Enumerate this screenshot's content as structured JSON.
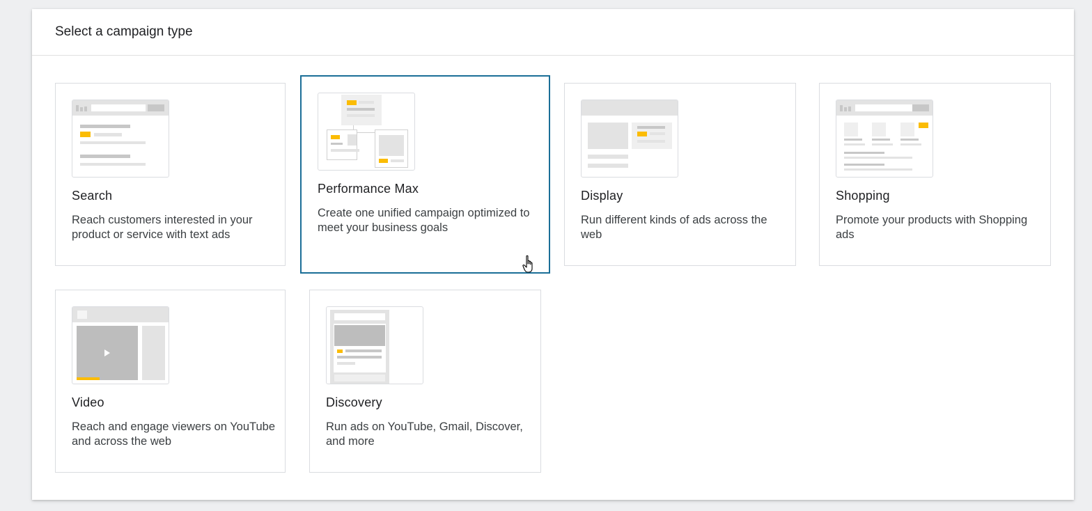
{
  "dialog": {
    "title": "Select a campaign type"
  },
  "campaign_types": [
    {
      "name": "Search",
      "description": "Reach customers interested in your product or service with text ads",
      "icon": "search-campaign-illustration"
    },
    {
      "name": "Performance Max",
      "description": "Create one unified campaign optimized to meet your business goals",
      "icon": "performance-max-campaign-illustration",
      "state": "hover"
    },
    {
      "name": "Display",
      "description": "Run different kinds of ads across the web",
      "icon": "display-campaign-illustration"
    },
    {
      "name": "Shopping",
      "description": "Promote your products with Shopping ads",
      "icon": "shopping-campaign-illustration"
    },
    {
      "name": "Video",
      "description": "Reach and engage viewers on YouTube and across the web",
      "icon": "video-campaign-illustration"
    },
    {
      "name": "Discovery",
      "description": "Run ads on YouTube, Gmail, Discover, and more",
      "icon": "discovery-campaign-illustration"
    }
  ],
  "colors": {
    "selected_border": "#1a6e97",
    "accent_yellow": "#fbbc04",
    "card_border": "#dadce0"
  }
}
